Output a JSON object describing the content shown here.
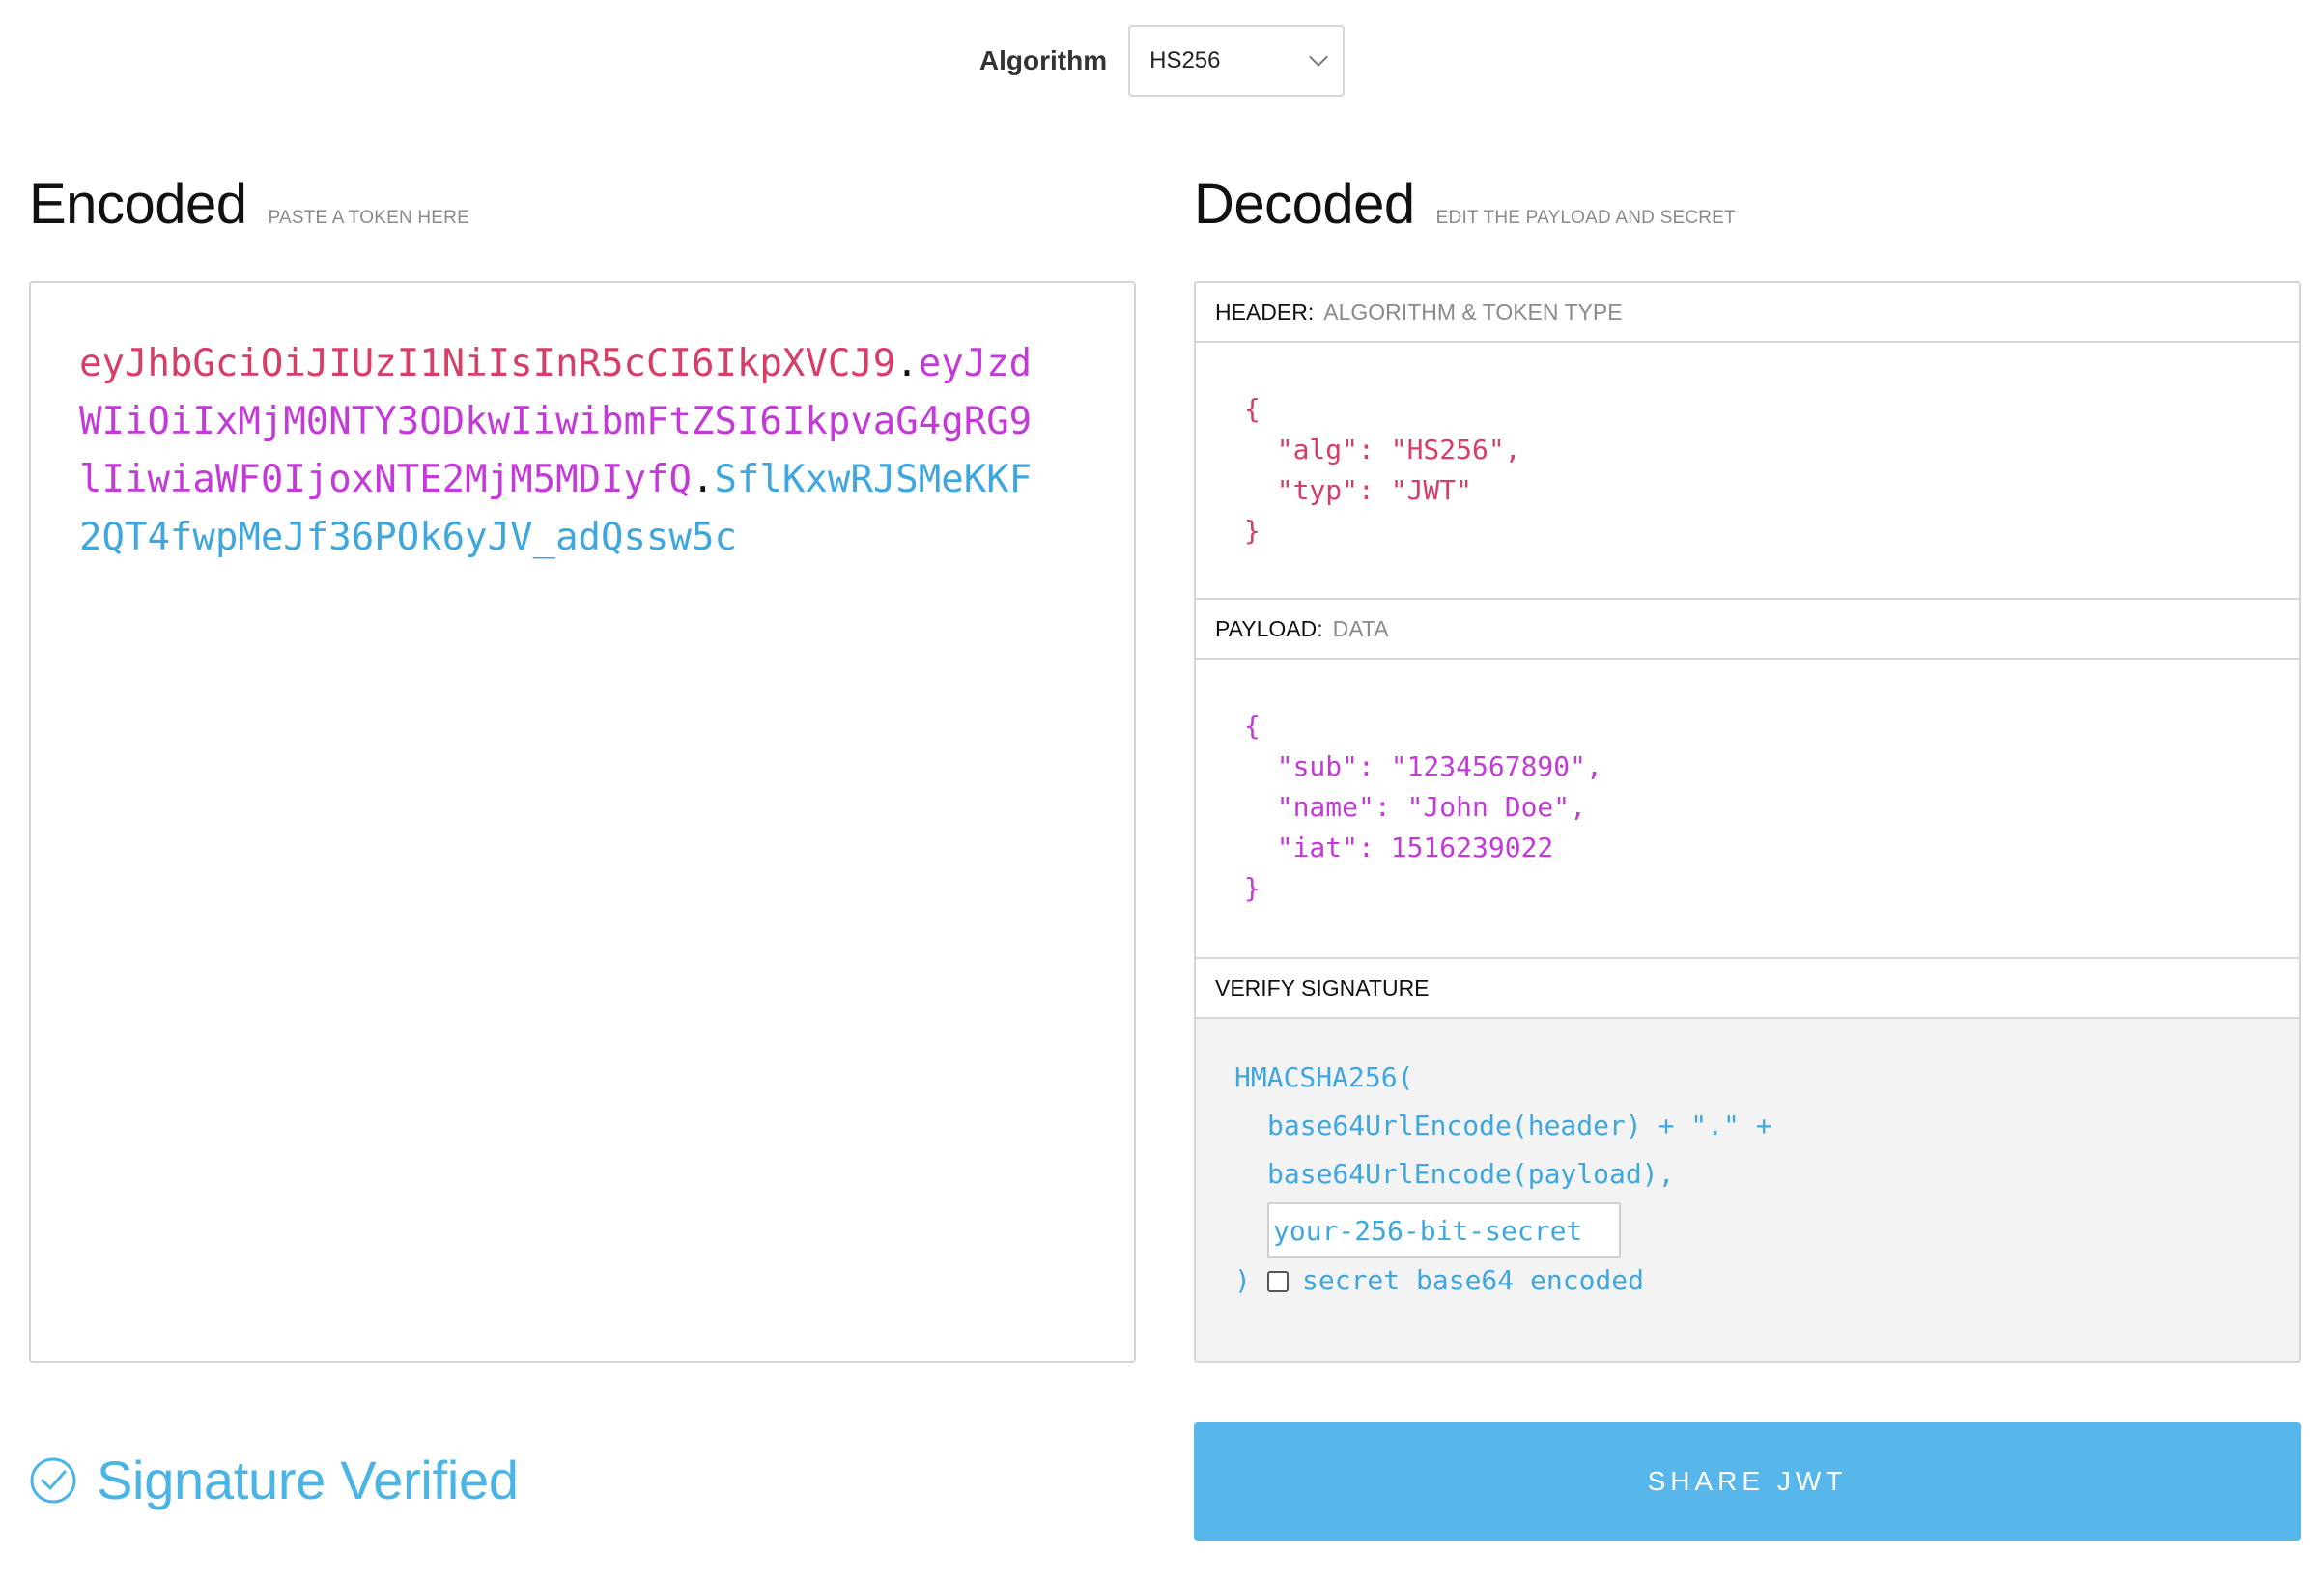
{
  "algorithm": {
    "label": "Algorithm",
    "selected": "HS256"
  },
  "encoded": {
    "title": "Encoded",
    "subtitle": "PASTE A TOKEN HERE",
    "token_header": "eyJhbGciOiJIUzI1NiIsInR5cCI6IkpXVCJ9",
    "token_payload": "eyJzdWIiOiIxMjM0NTY3ODkwIiwibmFtZSI6IkpvaG4gRG9lIiwiaWF0IjoxNTE2MjM5MDIyfQ",
    "token_signature": "SflKxwRJSMeKKF2QT4fwpMeJf36POk6yJV_adQssw5c",
    "dot": "."
  },
  "decoded": {
    "title": "Decoded",
    "subtitle": "EDIT THE PAYLOAD AND SECRET",
    "header_section": {
      "label": "HEADER:",
      "description": "ALGORITHM & TOKEN TYPE",
      "json": "{\n  \"alg\": \"HS256\",\n  \"typ\": \"JWT\"\n}"
    },
    "payload_section": {
      "label": "PAYLOAD:",
      "description": "DATA",
      "json": "{\n  \"sub\": \"1234567890\",\n  \"name\": \"John Doe\",\n  \"iat\": 1516239022\n}"
    },
    "verify_section": {
      "label": "VERIFY SIGNATURE",
      "line1": "HMACSHA256(",
      "line2": "base64UrlEncode(header) + \".\" +",
      "line3": "base64UrlEncode(payload),",
      "secret_placeholder": "your-256-bit-secret",
      "close_paren": ")",
      "checkbox_label": "secret base64 encoded"
    }
  },
  "status": {
    "text": "Signature Verified"
  },
  "share_button": {
    "label": "SHARE JWT"
  },
  "colors": {
    "header": "#d63d67",
    "payload": "#c43ad8",
    "signature": "#3fa7dd",
    "verified": "#4bb4e6",
    "share_button": "#57b6ea"
  },
  "icons": {
    "algorithm_dropdown": "chevron-down-icon",
    "status": "check-circle-icon"
  }
}
